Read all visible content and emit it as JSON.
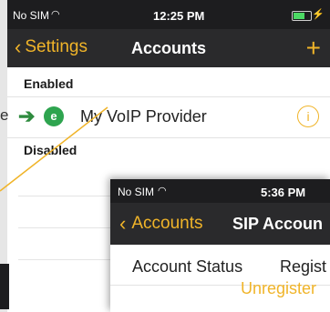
{
  "back_screen": {
    "status": {
      "carrier": "No SIM",
      "time": "12:25 PM"
    },
    "nav": {
      "back_label": "Settings",
      "title": "Accounts",
      "add_label": "+"
    },
    "sections": {
      "enabled": "Enabled",
      "disabled": "Disabled"
    },
    "account_row": {
      "left_cut_text": "e",
      "provider_name": "My VoIP Provider",
      "icon_letter": "e"
    }
  },
  "front_screen": {
    "status": {
      "carrier": "No SIM",
      "time": "5:36 PM"
    },
    "nav": {
      "back_label": "Accounts",
      "title": "SIP Accoun"
    },
    "account_status_label": "Account Status",
    "account_status_value": "Regist",
    "unregister_label": "Unregister"
  },
  "colors": {
    "accent": "#f0b429",
    "bar": "#2a2a2c",
    "status_bar": "#1d1d1f",
    "arrow": "#2e8b3e",
    "battery": "#4cd964"
  }
}
